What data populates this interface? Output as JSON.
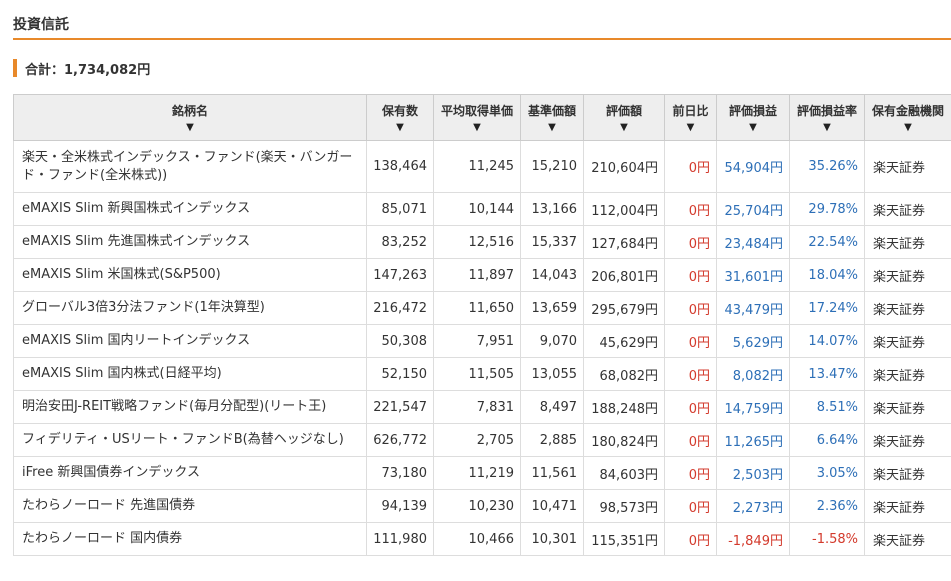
{
  "section": {
    "title": "投資信託"
  },
  "total": {
    "label": "合計：1,734,082円"
  },
  "table": {
    "sort_arrow": "▼",
    "headers": [
      "銘柄名",
      "保有数",
      "平均取得単価",
      "基準価額",
      "評価額",
      "前日比",
      "評価損益",
      "評価損益率",
      "保有金融機関"
    ],
    "rows": [
      {
        "name": "楽天・全米株式インデックス・ファンド(楽天・バンガード・ファンド(全米株式))",
        "qty": "138,464",
        "avg": "11,245",
        "base": "15,210",
        "value": "210,604円",
        "change": "0円",
        "gain": "54,904円",
        "rate": "35.26%",
        "broker": "楽天証券",
        "negative": false
      },
      {
        "name": "eMAXIS Slim 新興国株式インデックス",
        "qty": "85,071",
        "avg": "10,144",
        "base": "13,166",
        "value": "112,004円",
        "change": "0円",
        "gain": "25,704円",
        "rate": "29.78%",
        "broker": "楽天証券",
        "negative": false
      },
      {
        "name": "eMAXIS Slim 先進国株式インデックス",
        "qty": "83,252",
        "avg": "12,516",
        "base": "15,337",
        "value": "127,684円",
        "change": "0円",
        "gain": "23,484円",
        "rate": "22.54%",
        "broker": "楽天証券",
        "negative": false
      },
      {
        "name": "eMAXIS Slim 米国株式(S&P500)",
        "qty": "147,263",
        "avg": "11,897",
        "base": "14,043",
        "value": "206,801円",
        "change": "0円",
        "gain": "31,601円",
        "rate": "18.04%",
        "broker": "楽天証券",
        "negative": false
      },
      {
        "name": "グローバル3倍3分法ファンド(1年決算型)",
        "qty": "216,472",
        "avg": "11,650",
        "base": "13,659",
        "value": "295,679円",
        "change": "0円",
        "gain": "43,479円",
        "rate": "17.24%",
        "broker": "楽天証券",
        "negative": false
      },
      {
        "name": "eMAXIS Slim 国内リートインデックス",
        "qty": "50,308",
        "avg": "7,951",
        "base": "9,070",
        "value": "45,629円",
        "change": "0円",
        "gain": "5,629円",
        "rate": "14.07%",
        "broker": "楽天証券",
        "negative": false
      },
      {
        "name": "eMAXIS Slim 国内株式(日経平均)",
        "qty": "52,150",
        "avg": "11,505",
        "base": "13,055",
        "value": "68,082円",
        "change": "0円",
        "gain": "8,082円",
        "rate": "13.47%",
        "broker": "楽天証券",
        "negative": false
      },
      {
        "name": "明治安田J-REIT戦略ファンド(毎月分配型)(リート王)",
        "qty": "221,547",
        "avg": "7,831",
        "base": "8,497",
        "value": "188,248円",
        "change": "0円",
        "gain": "14,759円",
        "rate": "8.51%",
        "broker": "楽天証券",
        "negative": false
      },
      {
        "name": "フィデリティ・USリート・ファンドB(為替ヘッジなし)",
        "qty": "626,772",
        "avg": "2,705",
        "base": "2,885",
        "value": "180,824円",
        "change": "0円",
        "gain": "11,265円",
        "rate": "6.64%",
        "broker": "楽天証券",
        "negative": false
      },
      {
        "name": "iFree 新興国債券インデックス",
        "qty": "73,180",
        "avg": "11,219",
        "base": "11,561",
        "value": "84,603円",
        "change": "0円",
        "gain": "2,503円",
        "rate": "3.05%",
        "broker": "楽天証券",
        "negative": false
      },
      {
        "name": "たわらノーロード 先進国債券",
        "qty": "94,139",
        "avg": "10,230",
        "base": "10,471",
        "value": "98,573円",
        "change": "0円",
        "gain": "2,273円",
        "rate": "2.36%",
        "broker": "楽天証券",
        "negative": false
      },
      {
        "name": "たわらノーロード 国内債券",
        "qty": "111,980",
        "avg": "10,466",
        "base": "10,301",
        "value": "115,351円",
        "change": "0円",
        "gain": "-1,849円",
        "rate": "-1.58%",
        "broker": "楽天証券",
        "negative": true
      }
    ]
  },
  "colors": {
    "accent": "#e8892a",
    "positive": "#2d6fb7",
    "negative": "#d33a2c",
    "header_bg": "#eeeeee"
  }
}
